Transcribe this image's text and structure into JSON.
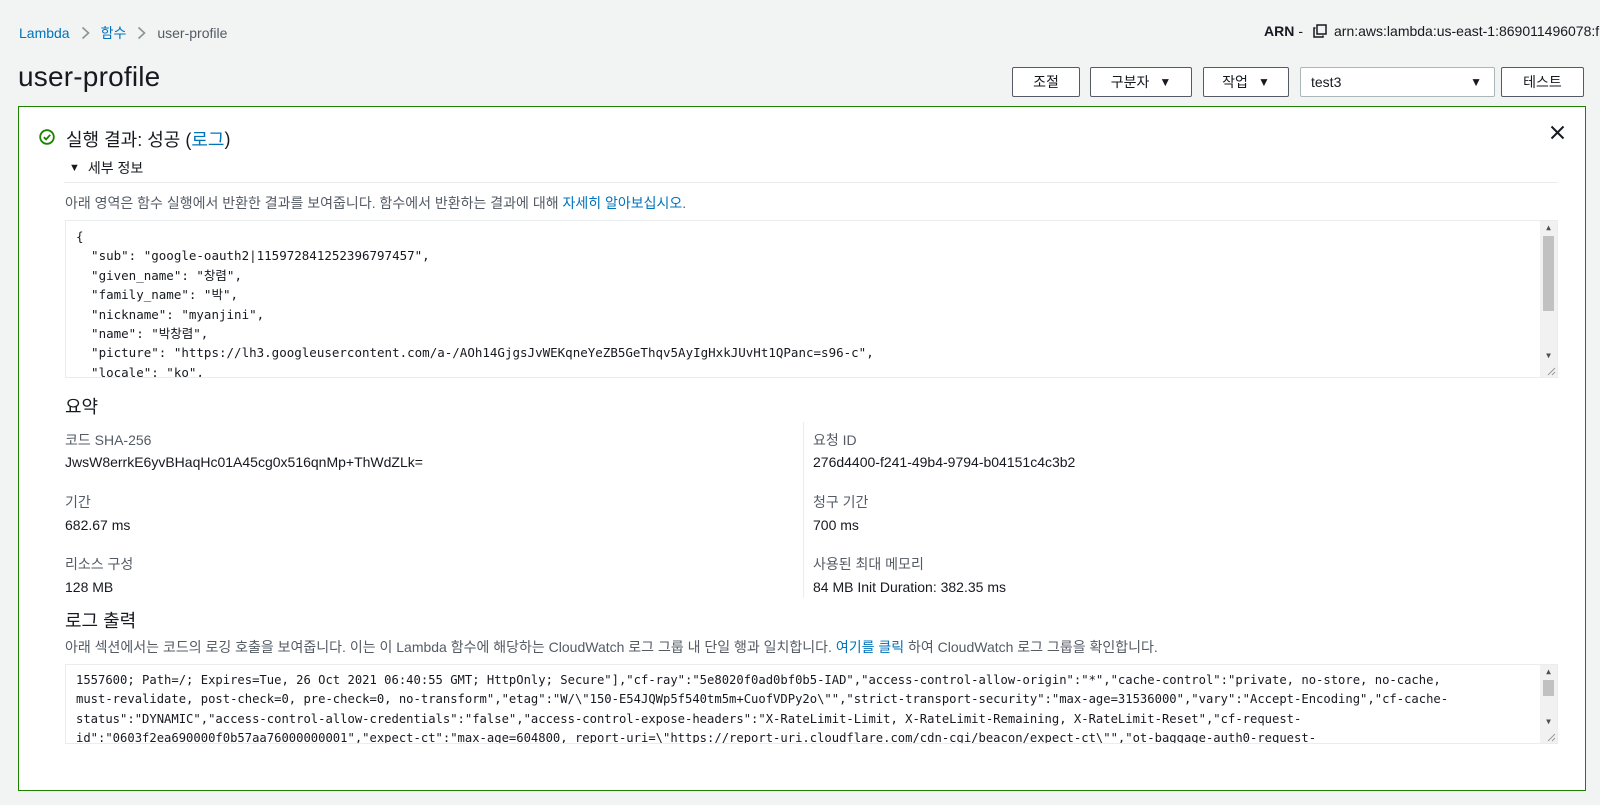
{
  "breadcrumb": {
    "items": [
      "Lambda",
      "함수"
    ],
    "current": "user-profile"
  },
  "arn": {
    "label": "ARN",
    "dash": "-",
    "value": "arn:aws:lambda:us-east-1:869011496078:f"
  },
  "page": {
    "title": "user-profile"
  },
  "actions": {
    "throttle": "조절",
    "qualifiers": "구분자",
    "actions": "작업",
    "test_event": "test3",
    "test": "테스트"
  },
  "result": {
    "title_prefix": "실행 결과: 성공 (",
    "log_link": "로그",
    "title_suffix": ")",
    "details_label": "세부 정보",
    "description": "아래 영역은 함수 실행에서 반환한 결과를 보여줍니다. 함수에서 반환하는 결과에 대해 ",
    "learn_more": "자세히 알아보십시오",
    "description_end": ".",
    "response_lines": [
      "{",
      "  \"sub\": \"google-oauth2|115972841252396797457\",",
      "  \"given_name\": \"창렴\",",
      "  \"family_name\": \"박\",",
      "  \"nickname\": \"myanjini\",",
      "  \"name\": \"박창렴\",",
      "  \"picture\": \"https://lh3.googleusercontent.com/a-/AOh14GjgsJvWEKqneYeZB5GeThqv5AyIgHxkJUvHt1QPanc=s96-c\",",
      "  \"locale\": \"ko\","
    ]
  },
  "summary": {
    "title": "요약",
    "code_sha_label": "코드 SHA-256",
    "code_sha_value": "JwsW8errkE6yvBHaqHc01A45cg0x516qnMp+ThWdZLk=",
    "request_id_label": "요청 ID",
    "request_id_value": "276d4400-f241-49b4-9794-b04151c4c3b2",
    "duration_label": "기간",
    "duration_value": "682.67 ms",
    "billed_label": "청구 기간",
    "billed_value": "700 ms",
    "resources_label": "리소스 구성",
    "resources_value": "128 MB",
    "max_memory_label": "사용된 최대 메모리",
    "max_memory_value": "84 MB Init Duration: 382.35 ms"
  },
  "log": {
    "title": "로그 출력",
    "description": "아래 섹션에서는 코드의 로깅 호출을 보여줍니다. 이는 이 Lambda 함수에 해당하는 CloudWatch 로그 그룹 내 단일 행과 일치합니다. ",
    "click_here": "여기를 클릭",
    "description_end": " 하여 CloudWatch 로그 그룹을 확인합니다.",
    "lines": [
      "1557600; Path=/; Expires=Tue, 26 Oct 2021 06:40:55 GMT; HttpOnly; Secure\"],\"cf-ray\":\"5e8020f0ad0bf0b5-IAD\",\"access-control-allow-origin\":\"*\",\"cache-control\":\"private, no-store, no-cache,",
      "must-revalidate, post-check=0, pre-check=0, no-transform\",\"etag\":\"W/\\\"150-E54JQWp5f540tm5m+CuofVDPy2o\\\"\",\"strict-transport-security\":\"max-age=31536000\",\"vary\":\"Accept-Encoding\",\"cf-cache-",
      "status\":\"DYNAMIC\",\"access-control-allow-credentials\":\"false\",\"access-control-expose-headers\":\"X-RateLimit-Limit, X-RateLimit-Remaining, X-RateLimit-Reset\",\"cf-request-",
      "id\":\"0603f2ea690000f0b57aa76000000001\",\"expect-ct\":\"max-age=604800, report-uri=\\\"https://report-uri.cloudflare.com/cdn-cgi/beacon/expect-ct\\\"\",\"ot-baggage-auth0-request-"
    ]
  },
  "colors": {
    "link": "#0073bb",
    "success": "#1d8102",
    "text": "#16191f",
    "muted": "#545b64"
  },
  "icons": [
    "chevron-right-icon",
    "copy-icon",
    "caret-down-icon",
    "success-check-icon",
    "close-icon",
    "caret-expanded-icon"
  ]
}
